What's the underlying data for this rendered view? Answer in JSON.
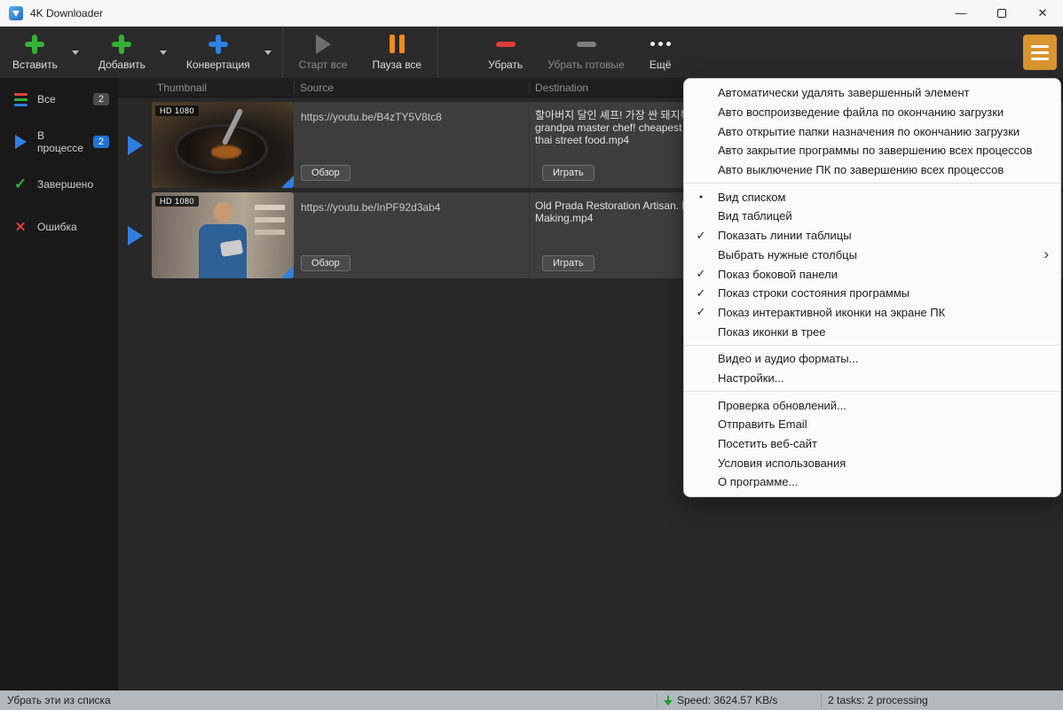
{
  "window": {
    "title": "4K Downloader"
  },
  "toolbar": {
    "paste_label": "Вставить",
    "add_label": "Добавить",
    "convert_label": "Конвертация",
    "start_all_label": "Старт все",
    "pause_all_label": "Пауза все",
    "remove_label": "Убрать",
    "remove_finished_label": "Убрать готовые",
    "more_label": "Ещё",
    "accent_green": "#34b234",
    "accent_blue": "#2f7fe0",
    "accent_orange": "#ef8a1a",
    "accent_red": "#e23b3b",
    "burger_color": "#d9952f"
  },
  "sidebar": {
    "items": [
      {
        "label": "Все",
        "badge": "2"
      },
      {
        "label": "В процессе",
        "badge": "2"
      },
      {
        "label": "Завершено",
        "badge": ""
      },
      {
        "label": "Ошибка",
        "badge": ""
      }
    ]
  },
  "table": {
    "headers": [
      "Thumbnail",
      "Source",
      "Destination"
    ],
    "rows": [
      {
        "quality": "HD 1080",
        "source_url": "https://youtu.be/B4zTY5V8tc8",
        "browse_label": "Обзор",
        "destination_lines": {
          "0": "할아버지 달인 셰프! 가장 싼 돼지볶",
          "1": "grandpa master chef! cheapest frie",
          "2": "thai street food.mp4"
        },
        "play_label": "Играть"
      },
      {
        "quality": "HD 1080",
        "source_url": "https://youtu.be/InPF92d3ab4",
        "browse_label": "Обзор",
        "destination_lines": {
          "0": "Old Prada Restoration Artisan. New",
          "1": "Making.mp4"
        },
        "play_label": "Играть"
      }
    ]
  },
  "menu": {
    "groups": [
      {
        "items": [
          {
            "label": "Автоматически удалять завершенный элемент",
            "state": ""
          },
          {
            "label": "Авто воспроизведение файла по окончанию загрузки",
            "state": ""
          },
          {
            "label": "Авто открытие папки назначения по окончанию загрузки",
            "state": ""
          },
          {
            "label": "Авто закрытие программы по завершению всех процессов",
            "state": ""
          },
          {
            "label": "Авто выключение ПК по завершению всех процессов",
            "state": ""
          }
        ]
      },
      {
        "items": [
          {
            "label": "Вид списком",
            "state": "radio"
          },
          {
            "label": "Вид таблицей",
            "state": ""
          },
          {
            "label": "Показать линии таблицы",
            "state": "checked"
          },
          {
            "label": "Выбрать нужные столбцы",
            "state": "submenu"
          },
          {
            "label": "Показ боковой панели",
            "state": "checked"
          },
          {
            "label": "Показ строки состояния программы",
            "state": "checked"
          },
          {
            "label": "Показ интерактивной иконки на экране ПК",
            "state": "checked"
          },
          {
            "label": "Показ иконки в трее",
            "state": ""
          }
        ]
      },
      {
        "items": [
          {
            "label": "Видео и аудио форматы...",
            "state": ""
          },
          {
            "label": "Настройки...",
            "state": ""
          }
        ]
      },
      {
        "items": [
          {
            "label": "Проверка обновлений...",
            "state": ""
          },
          {
            "label": "Отправить Email",
            "state": ""
          },
          {
            "label": "Посетить веб-сайт",
            "state": ""
          },
          {
            "label": "Условия использования",
            "state": ""
          },
          {
            "label": "О программе...",
            "state": ""
          }
        ]
      }
    ]
  },
  "statusbar": {
    "hint": "Убрать эти из списка",
    "speed": "Speed: 3624.57 KB/s",
    "tasks": "2 tasks: 2 processing"
  }
}
